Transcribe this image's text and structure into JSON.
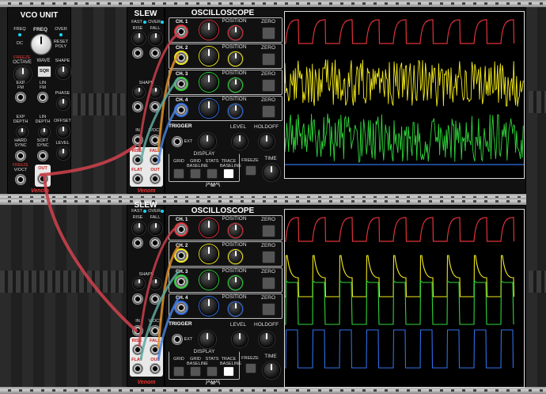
{
  "vco": {
    "title": "VCO UNIT",
    "freq_small": "FREQ",
    "freq_red": "",
    "freq": "FREQ",
    "over": "OVER",
    "dc": "DC",
    "reset_poly": "RESET\nPOLY",
    "freeze": "FREEZE",
    "octave": "OCTAVE",
    "wave": "WAVE",
    "shape": "SHAPE",
    "sqr": "SQR",
    "exp_fm": "EXP\nFM",
    "lin_fm": "LIN\nFM",
    "phase": "PHASE",
    "exp_depth": "EXP\nDEPTH",
    "lin_depth": "LIN\nDEPTH",
    "offset": "OFFSET",
    "hard_sync": "HARD\nSYNC",
    "soft_sync": "SOFT\nSYNC",
    "level": "LEVEL",
    "voct": "V/OCT",
    "out": "OUT",
    "brand": "Venom"
  },
  "slew": {
    "title": "SLEW",
    "fast": "FAST",
    "over": "OVER",
    "rise": "RISE",
    "fall": "FALL",
    "shape": "SHAPE",
    "in": "IN",
    "voct": "V/OCT",
    "flat": "FLAT",
    "out": "OUT",
    "brand": "Venom"
  },
  "scope": {
    "title": "OSCILLOSCOPE",
    "channels": [
      "CH. 1",
      "CH. 2",
      "CH. 3",
      "CH. 4"
    ],
    "position": "POSITION",
    "zero": "ZERO",
    "trigger": "TRIGGER",
    "ext": "EXT",
    "level": "LEVEL",
    "holdoff": "HOLDOFF",
    "display": "DISPLAY",
    "grid": "GRID",
    "grid_baseline": "GRID\nBASELINE",
    "stats": "STATS",
    "trace_baseline": "TRACE\nBASELINE",
    "freeze": "FREEZE",
    "time": "TIME",
    "logo": "/^M^\\",
    "colors": {
      "ch1": "#e0323a",
      "ch2": "#f2ea1b",
      "ch3": "#2fd43a",
      "ch4": "#2f6fe8"
    }
  }
}
